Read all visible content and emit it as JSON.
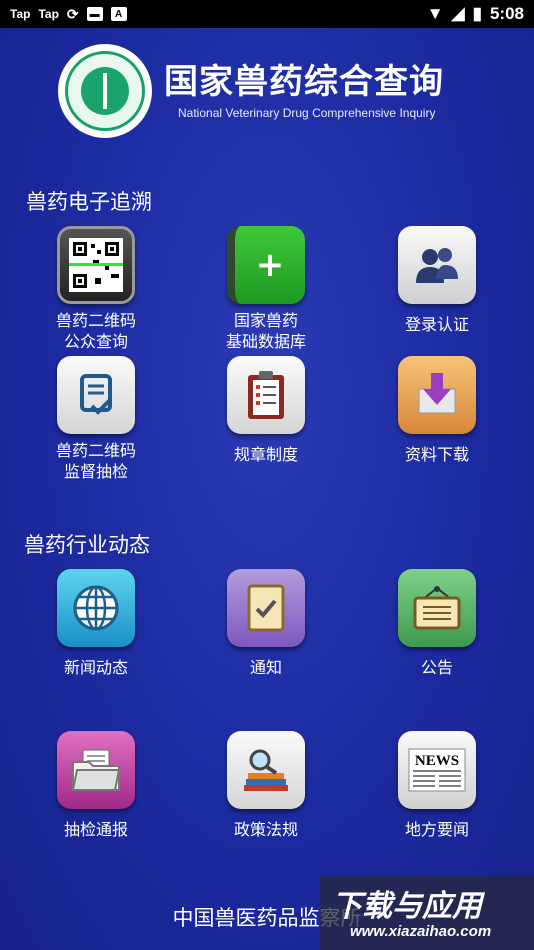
{
  "status_bar": {
    "left_items": [
      "Tap",
      "Tap"
    ],
    "time": "5:08"
  },
  "header": {
    "title": "国家兽药综合查询",
    "subtitle": "National Veterinary Drug Comprehensive Inquiry"
  },
  "section1": {
    "title": "兽药电子追溯",
    "tiles": [
      {
        "label": "兽药二维码\n公众查询",
        "icon": "qr-code-icon"
      },
      {
        "label": "国家兽药\n基础数据库",
        "icon": "add-book-icon"
      },
      {
        "label": "登录认证",
        "icon": "users-icon"
      },
      {
        "label": "兽药二维码\n监督抽检",
        "icon": "document-check-icon"
      },
      {
        "label": "规章制度",
        "icon": "clipboard-list-icon"
      },
      {
        "label": "资料下载",
        "icon": "download-icon"
      }
    ]
  },
  "section2": {
    "title": "兽药行业动态",
    "tiles": [
      {
        "label": "新闻动态",
        "icon": "globe-icon"
      },
      {
        "label": "通知",
        "icon": "notice-check-icon"
      },
      {
        "label": "公告",
        "icon": "bulletin-board-icon"
      },
      {
        "label": "抽检通报",
        "icon": "folder-icon"
      },
      {
        "label": "政策法规",
        "icon": "search-books-icon"
      },
      {
        "label": "地方要闻",
        "icon": "newspaper-icon"
      }
    ]
  },
  "footer": {
    "text": "中国兽医药品监察所"
  },
  "watermark": {
    "cn": "下载与应用",
    "en": "www.xiazaihao.com"
  },
  "colors": {
    "background": "#1c2aa0",
    "logo_green": "#1aa36b"
  }
}
